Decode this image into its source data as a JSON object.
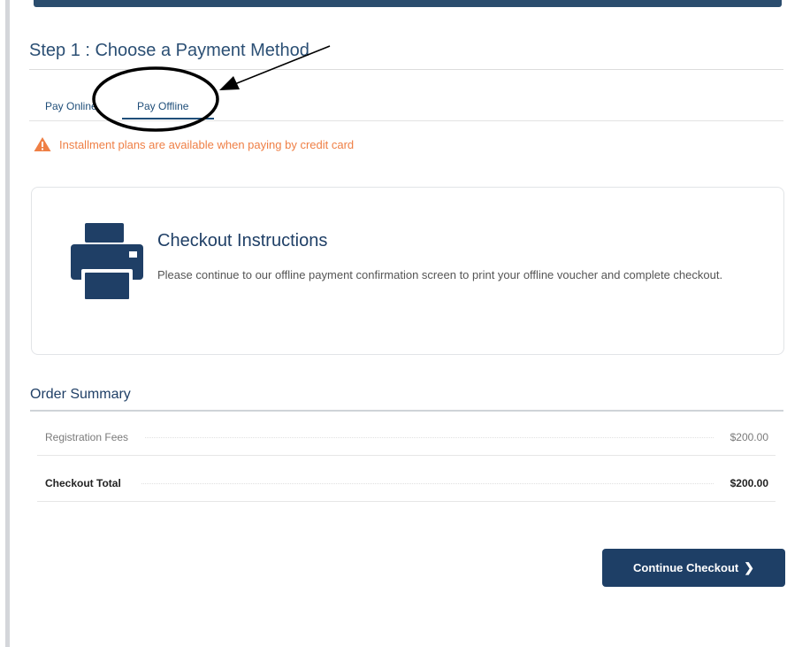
{
  "step": {
    "title": "Step 1 : Choose a Payment Method"
  },
  "tabs": [
    {
      "label": "Pay Online",
      "active": false
    },
    {
      "label": "Pay Offline",
      "active": true
    }
  ],
  "notice": {
    "text": "Installment plans are available when paying by credit card",
    "icon": "warning-icon",
    "color": "#ef7f45"
  },
  "checkout": {
    "icon": "printer-icon",
    "title": "Checkout Instructions",
    "body": "Please continue to our offline payment confirmation screen to print your offline voucher and complete checkout."
  },
  "summary": {
    "title": "Order Summary",
    "rows": [
      {
        "label": "Registration Fees",
        "value": "$200.00"
      },
      {
        "label": "Checkout Total",
        "value": "$200.00"
      }
    ]
  },
  "actions": {
    "continue_label": "Continue Checkout",
    "continue_icon": "chevron-right-icon"
  },
  "colors": {
    "primary": "#1e3f66",
    "warning": "#ef7f45"
  }
}
